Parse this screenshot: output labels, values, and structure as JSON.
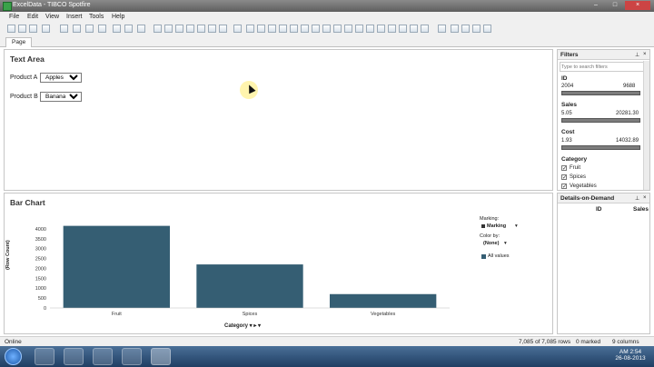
{
  "window": {
    "title": "ExcelData - TIBCO Spotfire",
    "buttons": [
      "–",
      "□",
      "×"
    ]
  },
  "menu": [
    "File",
    "Edit",
    "View",
    "Insert",
    "Tools",
    "Help"
  ],
  "page_tab": "Page",
  "text_area": {
    "title": "Text Area",
    "product_a": {
      "label": "Product A",
      "value": "Apples"
    },
    "product_b": {
      "label": "Product B",
      "value": "Bananas"
    }
  },
  "bar_chart": {
    "title": "Bar Chart",
    "y_axis_label": "(Row Count)",
    "x_axis_label": "Category",
    "marking": {
      "label": "Marking:",
      "value": "Marking"
    },
    "color_by": {
      "label": "Color by:",
      "value": "(None)"
    },
    "legend_item": "All values",
    "accent": "#355e73"
  },
  "chart_data": {
    "type": "bar",
    "categories": [
      "Fruit",
      "Spices",
      "Vegetables"
    ],
    "values": [
      4150,
      2200,
      700
    ],
    "ylabel": "(Row Count)",
    "xlabel": "Category",
    "yticks": [
      0,
      500,
      1000,
      1500,
      2000,
      2500,
      3000,
      3500,
      4000
    ],
    "ylim": [
      0,
      4500
    ],
    "legend": "right"
  },
  "filters": {
    "title": "Filters",
    "search_placeholder": "Type to search filters",
    "id": {
      "label": "ID",
      "min": "2004",
      "max": "9688"
    },
    "sales": {
      "label": "Sales",
      "min": "5.05",
      "max": "20281.30"
    },
    "cost": {
      "label": "Cost",
      "min": "1.93",
      "max": "14032.89"
    },
    "category": {
      "label": "Category",
      "items": [
        "Fruit",
        "Spices",
        "Vegetables"
      ]
    }
  },
  "details": {
    "title": "Details-on-Demand",
    "col_id": "ID",
    "col_sales": "Sales"
  },
  "status": {
    "left": "Online",
    "rows": "7,085 of 7,085 rows",
    "marked": "0 marked",
    "columns": "9 columns"
  },
  "taskbar": {
    "time": "AM 2:54",
    "date": "26-08-2013"
  }
}
